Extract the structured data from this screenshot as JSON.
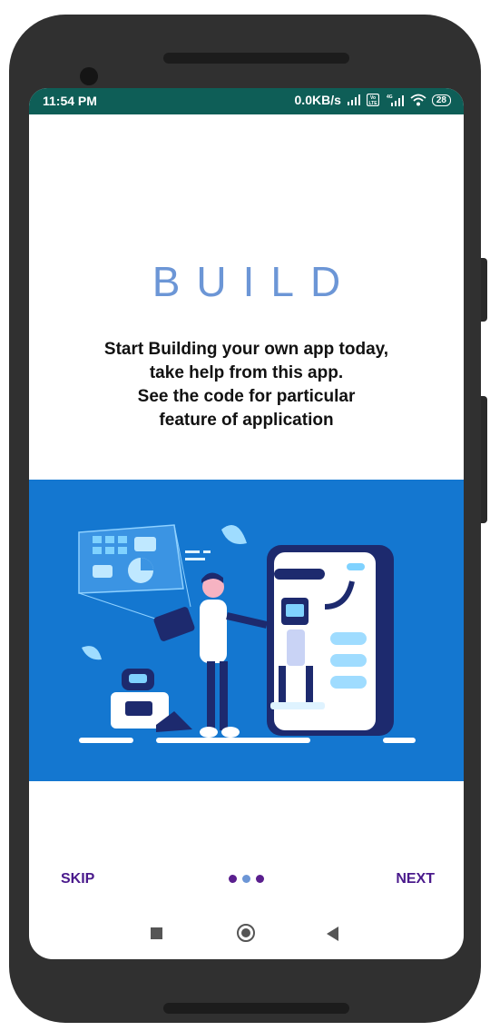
{
  "status_bar": {
    "time": "11:54 PM",
    "network_speed": "0.0KB/s",
    "battery_level": "28",
    "icons": [
      "signal-icon",
      "volte-icon",
      "4g-signal-icon",
      "wifi-icon",
      "battery-icon"
    ]
  },
  "main": {
    "title": "BUILD",
    "description_lines": [
      "Start Building your own app today,",
      "take help from this app.",
      "See the code for particular",
      "feature of application"
    ],
    "illustration": "developer-with-robot-illustration",
    "colors": {
      "title": "#6c96d6",
      "illustration_bg": "#1477d0"
    }
  },
  "footer": {
    "skip_label": "SKIP",
    "next_label": "NEXT",
    "page_count": 3,
    "active_page": 3,
    "colors": {
      "label": "#4a1a8c",
      "dot": "#5a1f8e",
      "dot_active": "#6c96d6"
    }
  },
  "navigation": {
    "icons": [
      "recent-apps-icon",
      "home-icon",
      "back-icon"
    ]
  }
}
